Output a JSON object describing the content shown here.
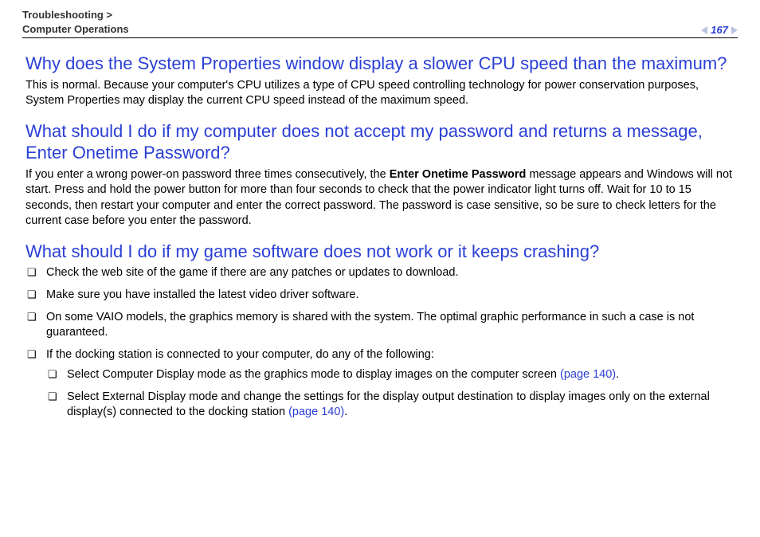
{
  "header": {
    "breadcrumb1": "Troubleshooting >",
    "breadcrumb2": "Computer Operations",
    "page_number": "167"
  },
  "sections": {
    "q1": {
      "title": "Why does the System Properties window display a slower CPU speed than the maximum?",
      "body": "This is normal. Because your computer's CPU utilizes a type of CPU speed controlling technology for power conservation purposes, System Properties may display the current CPU speed instead of the maximum speed."
    },
    "q2": {
      "title": "What should I do if my computer does not accept my password and returns a message, Enter Onetime Password?",
      "body_pre": "If you enter a wrong power-on password three times consecutively, the ",
      "body_bold": "Enter Onetime Password",
      "body_post": " message appears and Windows will not start. Press and hold the power button for more than four seconds to check that the power indicator light turns off. Wait for 10 to 15 seconds, then restart your computer and enter the correct password. The password is case sensitive, so be sure to check letters for the current case before you enter the password."
    },
    "q3": {
      "title": "What should I do if my game software does not work or it keeps crashing?",
      "items": {
        "i1": "Check the web site of the game if there are any patches or updates to download.",
        "i2": "Make sure you have installed the latest video driver software.",
        "i3": "On some VAIO models, the graphics memory is shared with the system. The optimal graphic performance in such a case is not guaranteed.",
        "i4": "If the docking station is connected to your computer, do any of the following:",
        "sub1_pre": "Select Computer Display mode as the graphics mode to display images on the computer screen ",
        "sub1_link": "(page 140)",
        "sub1_post": ".",
        "sub2_pre": "Select External Display mode and change the settings for the display output destination to display images only on the external display(s) connected to the docking station ",
        "sub2_link": "(page 140)",
        "sub2_post": "."
      }
    }
  }
}
